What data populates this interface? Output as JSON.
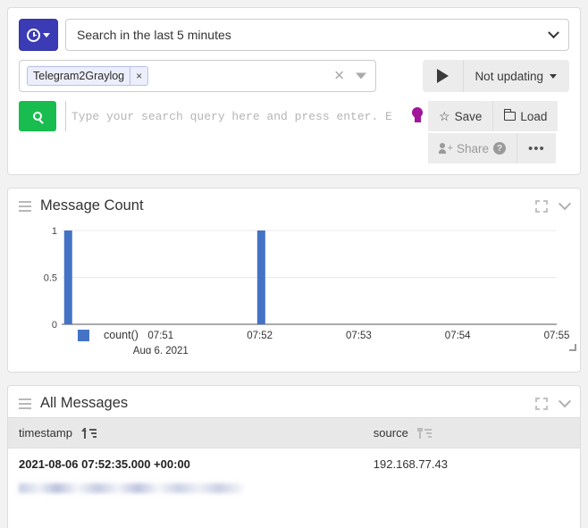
{
  "search": {
    "timepicker_icon": "clock-icon",
    "timerange_label": "Search in the last 5 minutes",
    "stream_pill": "Telegram2Graylog",
    "stream_pill_remove": "×",
    "stream_clear_all": "✕",
    "refresh_label": "Not updating",
    "query_placeholder": "Type your search query here and press enter. E",
    "save_label": "Save",
    "load_label": "Load",
    "share_label": "Share",
    "help_label": "?",
    "more_label": "•••"
  },
  "widgets": {
    "chart": {
      "title": "Message Count"
    },
    "table": {
      "title": "All Messages",
      "columns": [
        "timestamp",
        "source"
      ],
      "rows": [
        {
          "timestamp": "2021-08-06 07:52:35.000 +00:00",
          "source": "192.168.77.43",
          "message": ""
        }
      ]
    }
  },
  "chart_data": {
    "type": "bar",
    "title": "Message Count",
    "xlabel": "Aug 6, 2021",
    "ylabel": "",
    "x_tick_labels": [
      "07:51",
      "07:52",
      "07:53",
      "07:54",
      "07:55"
    ],
    "x_tick_positions": [
      0.2,
      0.4,
      0.6,
      0.8,
      1.0
    ],
    "y_tick_labels": [
      "0",
      "0.5",
      "1"
    ],
    "ylim": [
      0,
      1
    ],
    "grid": true,
    "legend_position": "bottom-left",
    "series": [
      {
        "name": "count()",
        "color": "#4472c4",
        "x": [
          "07:50:25",
          "07:52:35"
        ],
        "values": [
          1,
          1
        ],
        "bar_fractions": [
          0.005,
          0.395
        ]
      }
    ],
    "date_caption": "Aug 6, 2021"
  },
  "colors": {
    "brand_indigo": "#3b3bb5",
    "search_green": "#18bc4f",
    "bar_blue": "#4472c4",
    "bulb_magenta": "#a0159b"
  }
}
